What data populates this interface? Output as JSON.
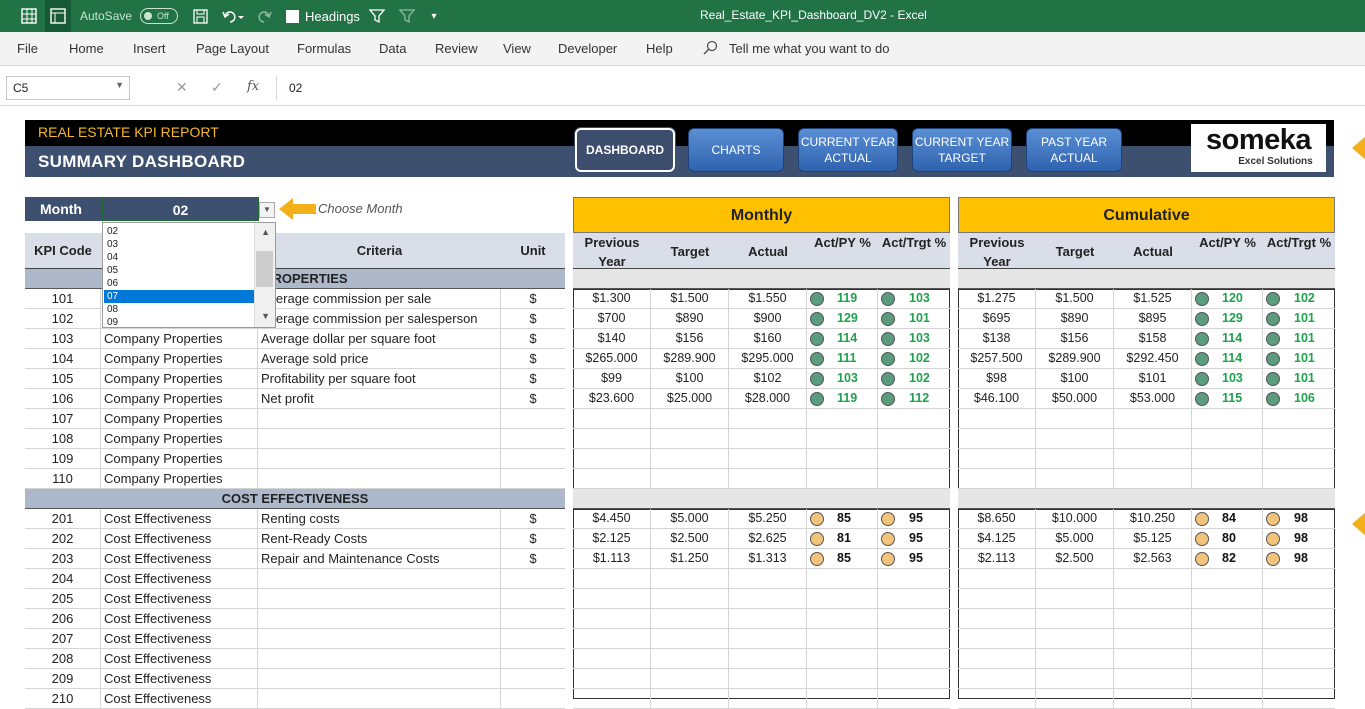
{
  "titlebar": {
    "autosave_label": "AutoSave",
    "autosave_state": "Off",
    "headings_label": "Headings",
    "document_title": "Real_Estate_KPI_Dashboard_DV2  -  Excel"
  },
  "ribbon_tabs": [
    "File",
    "Home",
    "Insert",
    "Page Layout",
    "Formulas",
    "Data",
    "Review",
    "View",
    "Developer",
    "Help"
  ],
  "tell_me": "Tell me what you want to do",
  "formula_bar": {
    "name_box": "C5",
    "fx": "fx",
    "value": "02"
  },
  "header": {
    "report_title": "REAL ESTATE KPI REPORT",
    "dashboard_title": "SUMMARY DASHBOARD",
    "buttons": [
      {
        "label": "DASHBOARD"
      },
      {
        "label": "CHARTS"
      },
      {
        "label": "CURRENT YEAR ACTUAL"
      },
      {
        "label": "CURRENT YEAR TARGET"
      },
      {
        "label": "PAST YEAR ACTUAL"
      }
    ],
    "logo_main": "someka",
    "logo_sub": "Excel Solutions"
  },
  "month_selector": {
    "label": "Month :",
    "value": "02",
    "hint": "Choose Month",
    "options": [
      "02",
      "03",
      "04",
      "05",
      "06",
      "07",
      "08",
      "09"
    ],
    "highlighted": "07"
  },
  "left_table": {
    "headers": [
      "KPI Code",
      "",
      "Criteria",
      "Unit"
    ],
    "sections": [
      {
        "title": "COMPANY PROPERTIES",
        "visible_title": "NY PROPERTIES",
        "rows": [
          {
            "code": "101",
            "group": "Company Properties",
            "criteria": "Average commission per sale",
            "unit": "$"
          },
          {
            "code": "102",
            "group": "Company Properties",
            "criteria": "Average commission per salesperson",
            "unit": "$"
          },
          {
            "code": "103",
            "group": "Company Properties",
            "criteria": "Average dollar per square foot",
            "unit": "$"
          },
          {
            "code": "104",
            "group": "Company Properties",
            "criteria": "Average sold price",
            "unit": "$"
          },
          {
            "code": "105",
            "group": "Company Properties",
            "criteria": "Profitability per square foot",
            "unit": "$"
          },
          {
            "code": "106",
            "group": "Company Properties",
            "criteria": "Net profit",
            "unit": "$"
          },
          {
            "code": "107",
            "group": "Company Properties",
            "criteria": "",
            "unit": ""
          },
          {
            "code": "108",
            "group": "Company Properties",
            "criteria": "",
            "unit": ""
          },
          {
            "code": "109",
            "group": "Company Properties",
            "criteria": "",
            "unit": ""
          },
          {
            "code": "110",
            "group": "Company Properties",
            "criteria": "",
            "unit": ""
          }
        ]
      },
      {
        "title": "COST EFFECTIVENESS",
        "visible_title": "COST EFFECTIVENESS",
        "rows": [
          {
            "code": "201",
            "group": "Cost Effectiveness",
            "criteria": "Renting costs",
            "unit": "$"
          },
          {
            "code": "202",
            "group": "Cost Effectiveness",
            "criteria": "Rent-Ready Costs",
            "unit": "$"
          },
          {
            "code": "203",
            "group": "Cost Effectiveness",
            "criteria": "Repair and Maintenance Costs",
            "unit": "$"
          },
          {
            "code": "204",
            "group": "Cost Effectiveness",
            "criteria": "",
            "unit": ""
          },
          {
            "code": "205",
            "group": "Cost Effectiveness",
            "criteria": "",
            "unit": ""
          },
          {
            "code": "206",
            "group": "Cost Effectiveness",
            "criteria": "",
            "unit": ""
          },
          {
            "code": "207",
            "group": "Cost Effectiveness",
            "criteria": "",
            "unit": ""
          },
          {
            "code": "208",
            "group": "Cost Effectiveness",
            "criteria": "",
            "unit": ""
          },
          {
            "code": "209",
            "group": "Cost Effectiveness",
            "criteria": "",
            "unit": ""
          },
          {
            "code": "210",
            "group": "Cost Effectiveness",
            "criteria": "",
            "unit": ""
          }
        ]
      }
    ]
  },
  "col_headers": {
    "prev_year": "Previous Year",
    "target": "Target",
    "actual": "Actual",
    "act_py": "Act/PY %",
    "act_trgt": "Act/Trgt %"
  },
  "monthly": {
    "title": "Monthly",
    "section1": [
      {
        "prev": "$1.300",
        "target": "$1.500",
        "actual": "$1.550",
        "py": "119",
        "trgt": "103",
        "py_status": "green",
        "trgt_status": "green"
      },
      {
        "prev": "$700",
        "target": "$890",
        "actual": "$900",
        "py": "129",
        "trgt": "101",
        "py_status": "green",
        "trgt_status": "green"
      },
      {
        "prev": "$140",
        "target": "$156",
        "actual": "$160",
        "py": "114",
        "trgt": "103",
        "py_status": "green",
        "trgt_status": "green"
      },
      {
        "prev": "$265.000",
        "target": "$289.900",
        "actual": "$295.000",
        "py": "111",
        "trgt": "102",
        "py_status": "green",
        "trgt_status": "green"
      },
      {
        "prev": "$99",
        "target": "$100",
        "actual": "$102",
        "py": "103",
        "trgt": "102",
        "py_status": "green",
        "trgt_status": "green"
      },
      {
        "prev": "$23.600",
        "target": "$25.000",
        "actual": "$28.000",
        "py": "119",
        "trgt": "112",
        "py_status": "green",
        "trgt_status": "green"
      }
    ],
    "section2": [
      {
        "prev": "$4.450",
        "target": "$5.000",
        "actual": "$5.250",
        "py": "85",
        "trgt": "95",
        "py_status": "orange",
        "trgt_status": "orange"
      },
      {
        "prev": "$2.125",
        "target": "$2.500",
        "actual": "$2.625",
        "py": "81",
        "trgt": "95",
        "py_status": "orange",
        "trgt_status": "orange"
      },
      {
        "prev": "$1.113",
        "target": "$1.250",
        "actual": "$1.313",
        "py": "85",
        "trgt": "95",
        "py_status": "orange",
        "trgt_status": "orange"
      }
    ]
  },
  "cumulative": {
    "title": "Cumulative",
    "section1": [
      {
        "prev": "$1.275",
        "target": "$1.500",
        "actual": "$1.525",
        "py": "120",
        "trgt": "102",
        "py_status": "green",
        "trgt_status": "green"
      },
      {
        "prev": "$695",
        "target": "$890",
        "actual": "$895",
        "py": "129",
        "trgt": "101",
        "py_status": "green",
        "trgt_status": "green"
      },
      {
        "prev": "$138",
        "target": "$156",
        "actual": "$158",
        "py": "114",
        "trgt": "101",
        "py_status": "green",
        "trgt_status": "green"
      },
      {
        "prev": "$257.500",
        "target": "$289.900",
        "actual": "$292.450",
        "py": "114",
        "trgt": "101",
        "py_status": "green",
        "trgt_status": "green"
      },
      {
        "prev": "$98",
        "target": "$100",
        "actual": "$101",
        "py": "103",
        "trgt": "101",
        "py_status": "green",
        "trgt_status": "green"
      },
      {
        "prev": "$46.100",
        "target": "$50.000",
        "actual": "$53.000",
        "py": "115",
        "trgt": "106",
        "py_status": "green",
        "trgt_status": "green"
      }
    ],
    "section2": [
      {
        "prev": "$8.650",
        "target": "$10.000",
        "actual": "$10.250",
        "py": "84",
        "trgt": "98",
        "py_status": "orange",
        "trgt_status": "orange"
      },
      {
        "prev": "$4.125",
        "target": "$5.000",
        "actual": "$5.125",
        "py": "80",
        "trgt": "98",
        "py_status": "orange",
        "trgt_status": "orange"
      },
      {
        "prev": "$2.113",
        "target": "$2.500",
        "actual": "$2.563",
        "py": "82",
        "trgt": "98",
        "py_status": "orange",
        "trgt_status": "orange"
      }
    ]
  },
  "colors": {
    "excel_green": "#217346",
    "navy": "#3e5070",
    "gold": "#ffc000",
    "status_green": "#5b9b7e",
    "status_orange": "#f2c37a",
    "pct_green": "#1fa14e"
  }
}
